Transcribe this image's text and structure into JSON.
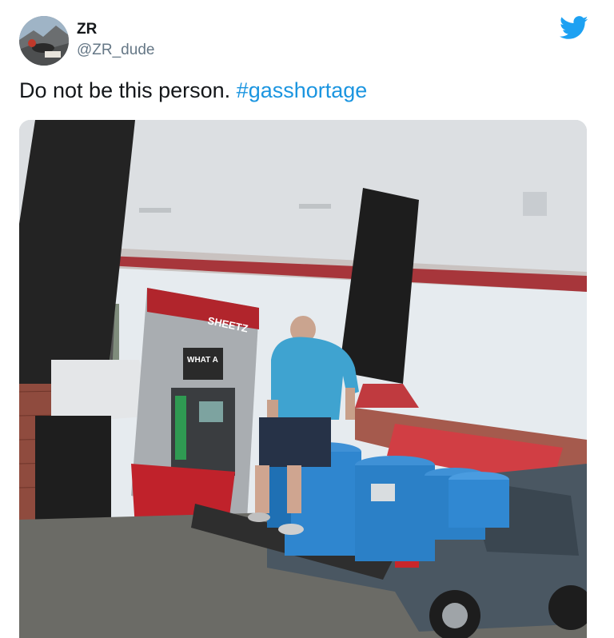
{
  "tweet": {
    "display_name": "ZR",
    "handle": "@ZR_dude",
    "text_plain": "Do not be this person. ",
    "hashtag": "#gasshortage"
  },
  "photo": {
    "pump_brand": "SHEETZ",
    "pump_sign": "WHAT A"
  },
  "icons": {
    "logo": "twitter-bird-icon"
  },
  "colors": {
    "link": "#1b95e0",
    "brand": "#1da1f2",
    "text": "#14171a",
    "muted": "#657786"
  }
}
